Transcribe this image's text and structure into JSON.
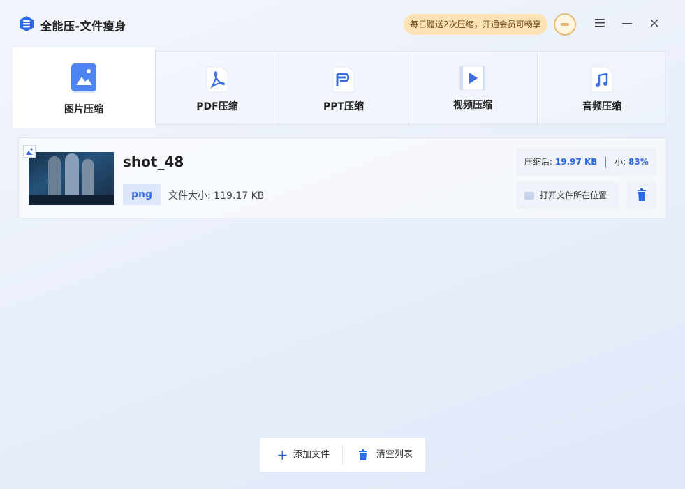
{
  "app": {
    "title": "全能压-文件瘦身",
    "promo": "每日赠送2次压缩，开通会员可畅享",
    "accent_color": "#2e6ae0"
  },
  "window_controls": {
    "menu_icon": "hamburger-icon",
    "minimize_icon": "minimize-icon",
    "close_icon": "close-icon"
  },
  "tabs": [
    {
      "label": "图片压缩",
      "icon": "image-icon",
      "active": true
    },
    {
      "label": "PDF压缩",
      "icon": "pdf-icon",
      "active": false
    },
    {
      "label": "PPT压缩",
      "icon": "ppt-icon",
      "active": false
    },
    {
      "label": "视频压缩",
      "icon": "video-icon",
      "active": false
    },
    {
      "label": "音频压缩",
      "icon": "audio-icon",
      "active": false
    }
  ],
  "file": {
    "name": "shot_48",
    "format": "png",
    "size_label": "文件大小: 119.17 KB",
    "result_prefix": "压缩后:",
    "result_size": "19.97 KB",
    "reduction_prefix": "小:",
    "reduction": "83%",
    "open_folder_label": "打开文件所在位置"
  },
  "bottom": {
    "add_label": "添加文件",
    "clear_label": "清空列表"
  }
}
